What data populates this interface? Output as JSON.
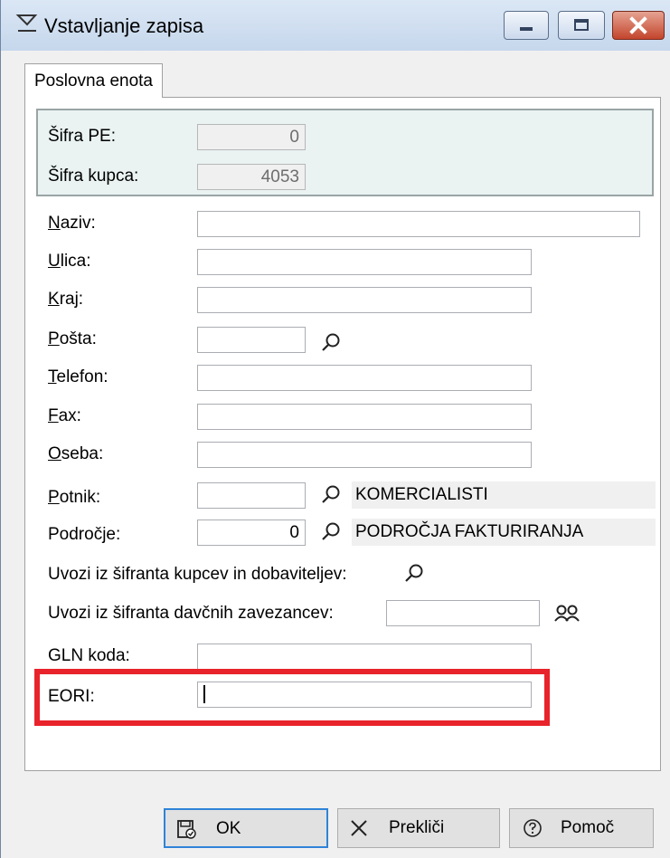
{
  "window": {
    "title": "Vstavljanje zapisa"
  },
  "tab": {
    "label": "Poslovna enota"
  },
  "readonly": {
    "sifra_pe_label": "Šifra PE:",
    "sifra_pe_value": "0",
    "sifra_kupca_label": "Šifra kupca:",
    "sifra_kupca_value": "4053"
  },
  "fields": {
    "naziv": {
      "label_mnemonic": "N",
      "label_rest": "aziv:",
      "value": ""
    },
    "ulica": {
      "label_mnemonic": "U",
      "label_rest": "lica:",
      "value": ""
    },
    "kraj": {
      "label_mnemonic": "K",
      "label_rest": "raj:",
      "value": ""
    },
    "posta": {
      "label_mnemonic": "P",
      "label_rest": "ošta:",
      "value": ""
    },
    "telefon": {
      "label_mnemonic": "T",
      "label_rest": "elefon:",
      "value": ""
    },
    "fax": {
      "label_mnemonic": "F",
      "label_rest": "ax:",
      "value": ""
    },
    "oseba": {
      "label_mnemonic": "O",
      "label_rest": "seba:",
      "value": ""
    },
    "potnik": {
      "label_mnemonic": "P",
      "label_rest": "otnik:",
      "value": "",
      "ref_text": "KOMERCIALISTI"
    },
    "podrocje": {
      "label": "Področje:",
      "value": "0",
      "ref_text": "PODROČJA FAKTURIRANJA"
    },
    "uvozi_kupcev": {
      "label": "Uvozi iz šifranta kupcev in dobaviteljev:"
    },
    "uvozi_davcnih": {
      "label": "Uvozi iz šifranta davčnih zavezancev:",
      "value": ""
    },
    "gln": {
      "label": "GLN koda:",
      "value": ""
    },
    "eori": {
      "label": "EORI:",
      "value": ""
    }
  },
  "buttons": {
    "ok": "OK",
    "cancel": "Prekliči",
    "help": "Pomoč"
  },
  "colors": {
    "highlight": "#e8232b",
    "ok_border": "#2f83d7"
  },
  "icons": [
    "title-sigma-icon",
    "minimize-icon",
    "maximize-icon",
    "close-icon",
    "search-icon",
    "people-search-icon",
    "save-icon",
    "x-icon",
    "help-icon"
  ]
}
